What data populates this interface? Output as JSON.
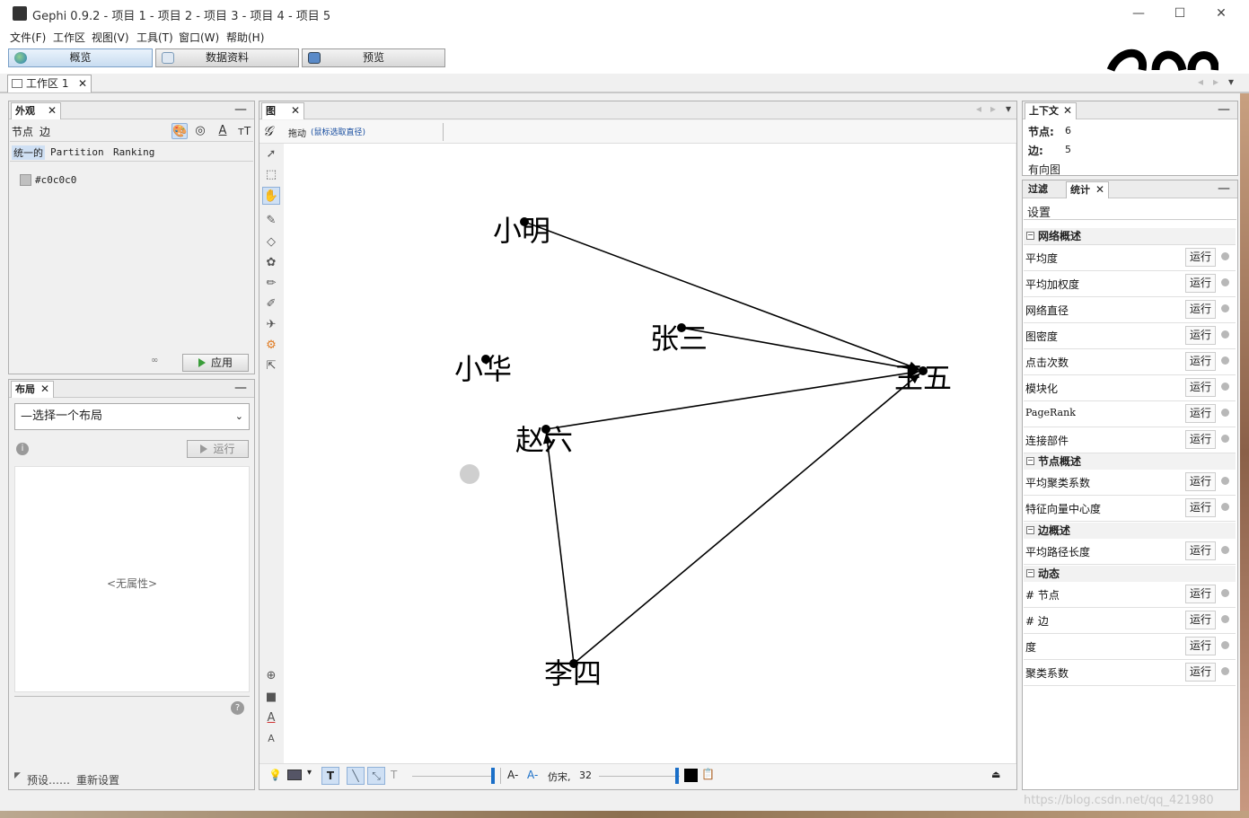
{
  "window": {
    "title": "Gephi 0.9.2 - 项目 1 - 项目 2 - 项目 3 - 项目 4 - 项目 5",
    "minimize": "—",
    "maximize": "☐",
    "close": "✕"
  },
  "menu": [
    "文件(F)",
    "工作区",
    "视图(V)",
    "工具(T)",
    "窗口(W)",
    "帮助(H)"
  ],
  "modes": [
    {
      "label": "概览",
      "active": true
    },
    {
      "label": "数据资料",
      "active": false
    },
    {
      "label": "预览",
      "active": false
    }
  ],
  "workspace_tab": {
    "label": "工作区 1",
    "close": "✕"
  },
  "appearance": {
    "tab": "外观",
    "subtabs": [
      "节点",
      "边"
    ],
    "modes": [
      "统一的",
      "Partition",
      "Ranking"
    ],
    "color_value": "#c0c0c0",
    "color_swatch": "#c0c0c0",
    "apply_button": "应用"
  },
  "layout": {
    "tab": "布局",
    "select_value": "—选择一个布局",
    "run_button": "运行",
    "no_properties": "<无属性>",
    "presets": "预设……",
    "reset": "重新设置"
  },
  "graph": {
    "tab": "图",
    "drag_label": "拖动",
    "drag_hint": "(鼠标选取直径)",
    "font_name": "仿宋,",
    "font_size": "32"
  },
  "graph_data": {
    "nodes": [
      {
        "id": "xiaoming",
        "label": "小明"
      },
      {
        "id": "zhangsan",
        "label": "张三"
      },
      {
        "id": "xiaohua",
        "label": "小华"
      },
      {
        "id": "zhaoliu",
        "label": "赵六"
      },
      {
        "id": "lisi",
        "label": "李四"
      },
      {
        "id": "wangwu",
        "label": "王五"
      }
    ],
    "edges": [
      {
        "from": "xiaoming",
        "to": "wangwu"
      },
      {
        "from": "zhangsan",
        "to": "wangwu"
      },
      {
        "from": "zhaoliu",
        "to": "wangwu"
      },
      {
        "from": "lisi",
        "to": "wangwu"
      },
      {
        "from": "lisi",
        "to": "zhaoliu"
      }
    ]
  },
  "context": {
    "tab": "上下文",
    "nodes_label": "节点:",
    "nodes_value": "6",
    "edges_label": "边:",
    "edges_value": "5",
    "graph_type": "有向图"
  },
  "statistics": {
    "tab_filter": "过滤",
    "tab_stats": "统计",
    "settings": "设置",
    "run_label": "运行",
    "sections": [
      {
        "title": "网络概述",
        "items": [
          "平均度",
          "平均加权度",
          "网络直径",
          "图密度",
          "点击次数",
          "模块化",
          "PageRank",
          "连接部件"
        ]
      },
      {
        "title": "节点概述",
        "items": [
          "平均聚类系数",
          "特征向量中心度"
        ]
      },
      {
        "title": "边概述",
        "items": [
          "平均路径长度"
        ]
      },
      {
        "title": "动态",
        "items": [
          "# 节点",
          "# 边",
          "度",
          "聚类系数"
        ]
      }
    ]
  },
  "watermark": "https://blog.csdn.net/qq_421980"
}
